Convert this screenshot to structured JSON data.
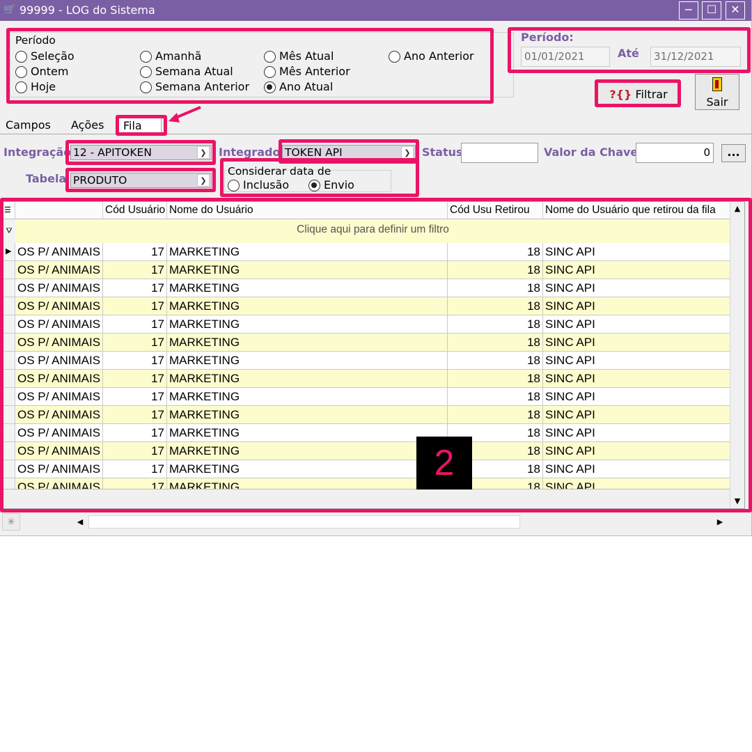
{
  "window": {
    "title": "99999 - LOG do Sistema",
    "minimize": "−",
    "maximize": "☐",
    "close": "✕"
  },
  "periodo_group": {
    "legend": "Período",
    "options": [
      {
        "label": "Seleção",
        "selected": false
      },
      {
        "label": "Ontem",
        "selected": false
      },
      {
        "label": "Hoje",
        "selected": false
      },
      {
        "label": "Amanhã",
        "selected": false
      },
      {
        "label": "Semana Atual",
        "selected": false
      },
      {
        "label": "Semana Anterior",
        "selected": false
      },
      {
        "label": "Mês Atual",
        "selected": false
      },
      {
        "label": "Mês Anterior",
        "selected": false
      },
      {
        "label": "Ano Atual",
        "selected": true
      },
      {
        "label": "Ano Anterior",
        "selected": false
      }
    ]
  },
  "date_range": {
    "label": "Período:",
    "from": "01/01/2021",
    "until_label": "Até",
    "to": "31/12/2021"
  },
  "actions": {
    "filter_label": "Filtrar",
    "filter_icon": "?{}",
    "exit_label": "Sair"
  },
  "tabs": [
    {
      "label": "Campos",
      "active": false
    },
    {
      "label": "Ações",
      "active": false
    },
    {
      "label": "Fila",
      "active": true
    }
  ],
  "filters": {
    "integracao_label": "Integração",
    "integracao_value": "12 - APITOKEN",
    "integrador_label": "Integrador",
    "integrador_value": "TOKEN API",
    "status_label": "Status",
    "status_value": "",
    "valor_chave_label": "Valor da Chave",
    "valor_chave_value": "0",
    "more_button": "...",
    "tabela_label": "Tabela",
    "tabela_value": "PRODUTO",
    "considerar_legend": "Considerar data de",
    "considerar_options": [
      {
        "label": "Inclusão",
        "selected": false
      },
      {
        "label": "Envio",
        "selected": true
      }
    ]
  },
  "grid": {
    "columns": [
      "",
      "Cód Usuário",
      "Nome do Usuário",
      "Cód Usu Retirou",
      "Nome do Usuário que retirou da fila"
    ],
    "filter_hint": "Clique aqui para definir um filtro",
    "rows": [
      [
        "OS P/ ANIMAIS L",
        "17",
        "MARKETING",
        "18",
        "SINC API"
      ],
      [
        "OS P/ ANIMAIS L",
        "17",
        "MARKETING",
        "18",
        "SINC API"
      ],
      [
        "OS P/ ANIMAIS L",
        "17",
        "MARKETING",
        "18",
        "SINC API"
      ],
      [
        "OS P/ ANIMAIS L",
        "17",
        "MARKETING",
        "18",
        "SINC API"
      ],
      [
        "OS P/ ANIMAIS L",
        "17",
        "MARKETING",
        "18",
        "SINC API"
      ],
      [
        "OS P/ ANIMAIS L",
        "17",
        "MARKETING",
        "18",
        "SINC API"
      ],
      [
        "OS P/ ANIMAIS L",
        "17",
        "MARKETING",
        "18",
        "SINC API"
      ],
      [
        "OS P/ ANIMAIS L",
        "17",
        "MARKETING",
        "18",
        "SINC API"
      ],
      [
        "OS P/ ANIMAIS L",
        "17",
        "MARKETING",
        "18",
        "SINC API"
      ],
      [
        "OS P/ ANIMAIS L",
        "17",
        "MARKETING",
        "18",
        "SINC API"
      ],
      [
        "OS P/ ANIMAIS L",
        "17",
        "MARKETING",
        "18",
        "SINC API"
      ],
      [
        "OS P/ ANIMAIS L",
        "17",
        "MARKETING",
        "18",
        "SINC API"
      ],
      [
        "OS P/ ANIMAIS L",
        "17",
        "MARKETING",
        "18",
        "SINC API"
      ],
      [
        "OS P/ ANIMAIS L",
        "17",
        "MARKETING",
        "18",
        "SINC API"
      ]
    ]
  },
  "annotation": {
    "badge": "2"
  },
  "colors": {
    "titlebar": "#7b5fa4",
    "highlight": "#ea1467",
    "row_alt": "#fdfccd"
  }
}
